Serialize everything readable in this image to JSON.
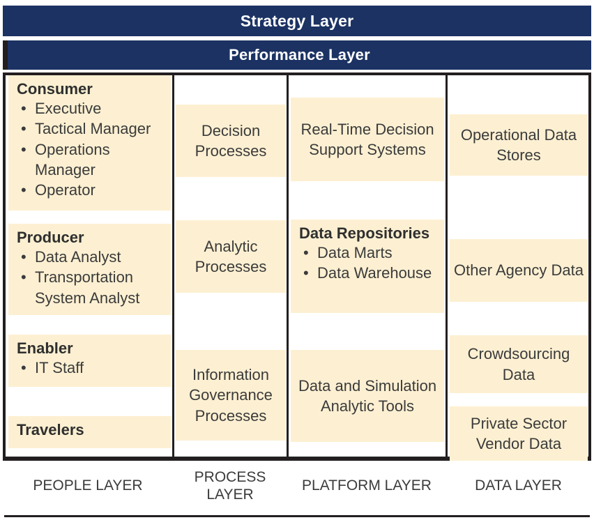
{
  "banners": {
    "strategy": "Strategy Layer",
    "performance": "Performance Layer"
  },
  "colors": {
    "banner_navy": "#1b3263",
    "box_cream": "#fdf0d2",
    "rule_black": "#231f20",
    "text_dark": "#3b3b3b"
  },
  "columns": {
    "people": {
      "footer_label": "PEOPLE LAYER",
      "groups": [
        {
          "heading": "Consumer",
          "items": [
            "Executive",
            "Tactical Manager",
            "Operations Manager",
            "Operator"
          ]
        },
        {
          "heading": "Producer",
          "items": [
            "Data Analyst",
            "Transportation System Analyst"
          ]
        },
        {
          "heading": "Enabler",
          "items": [
            "IT Staff"
          ]
        },
        {
          "heading": "Travelers",
          "items": []
        }
      ]
    },
    "process": {
      "footer_label": "PROCESS LAYER",
      "boxes": [
        {
          "title": "Decision Processes"
        },
        {
          "title": "Analytic Processes"
        },
        {
          "title": "Information Governance Processes"
        }
      ]
    },
    "platform": {
      "footer_label": "PLATFORM LAYER",
      "boxes": [
        {
          "title": "Real-Time Decision Support Systems"
        },
        {
          "heading": "Data Repositories",
          "items": [
            "Data Marts",
            "Data Warehouse"
          ]
        },
        {
          "title": "Data and Simulation Analytic Tools"
        }
      ]
    },
    "data": {
      "footer_label": "DATA LAYER",
      "boxes": [
        {
          "title": "Operational Data Stores"
        },
        {
          "title": "Other Agency Data"
        },
        {
          "title": "Crowdsourcing Data"
        },
        {
          "title": "Private Sector Vendor Data"
        }
      ]
    }
  },
  "bullet_glyph": "•"
}
